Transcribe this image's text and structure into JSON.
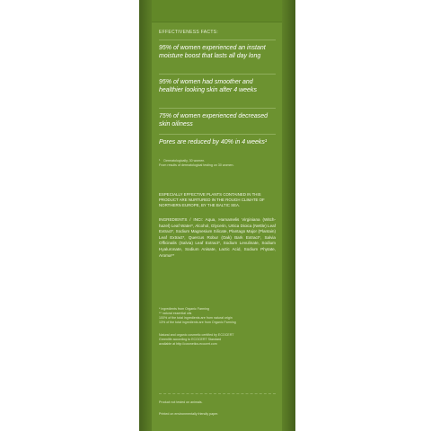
{
  "facts": {
    "title": "EFFECTIVENESS FACTS:",
    "items": [
      "95% of women experienced an instant moisture boost that lasts all day long",
      "95% of women had smoother and healthier looking skin after 4 weeks",
      "75% of women experienced decreased skin oiliness",
      "Pores are reduced by 40% in 4 weeks¹"
    ],
    "footnote_mark": "¹",
    "footnote_line1": "Dermatologically, 30 women.",
    "footnote_line2": "From results of dermatological testing on 30 women."
  },
  "plants": {
    "text": "ESPECIALLY EFFECTIVE PLANTS CONTAINED IN THIS PRODUCT ARE NURTURED IN THE ROUGH CLIMATE OF NORTHERN EUROPE, BY THE BALTIC SEA."
  },
  "ingredients": {
    "text": "INGREDIENTS / INCI: Aqua, Hamamelis Virginiana (Witch-hazel) Leaf Water*, Alcohol, Glycerin, Urtica Dioica (Nettle) Leaf Extract*, Sodium Magnesium Silicate, Plantago Major (Plantain) Leaf Extract*, Quercus Robur (Oak) Bark Extract*, Salvia Officinalis (Salvia) Leaf Extract*, Sodium Levulinate, Sodium Hyaluronate, Sodium Anisate, Lactic Acid, Sodium Phytate, Aroma**"
  },
  "notes": {
    "organic": "* ingredients from Organic Farming",
    "essential": "** natural essential oils",
    "origin1": "100% of the total ingredients are from natural origin",
    "origin2": "13% of the total ingredients are from Organic Farming"
  },
  "certification": {
    "line1": "Natural and organic cosmetic certified by ECOCERT",
    "line2": "Greenlife according to ECOCERT Standard",
    "line3": "available at http://cosmetics.ecocert.com"
  },
  "bottom": {
    "animals": "Product not tested on animals.",
    "paper": "Printed on environmentally friendly paper."
  }
}
